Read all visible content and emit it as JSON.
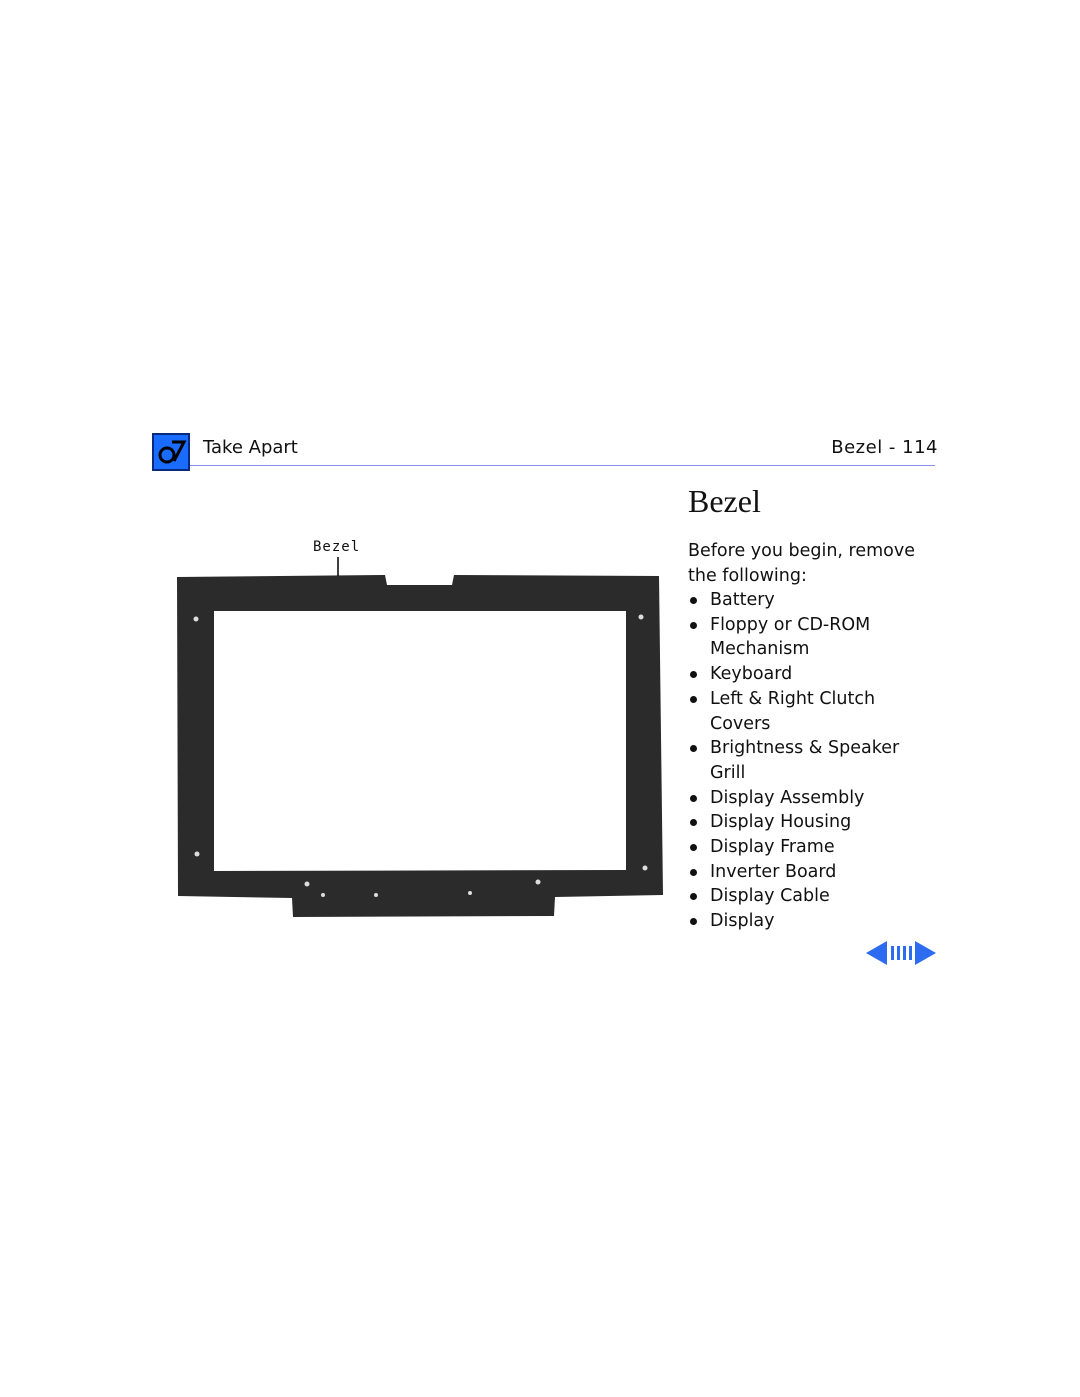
{
  "header": {
    "section": "Take Apart",
    "page_ref": "Bezel - 114",
    "logo_icon": "take-apart-wrench-icon",
    "accent_color": "#1a6cff"
  },
  "main": {
    "title": "Bezel",
    "intro": "Before you begin, remove the following:",
    "items": [
      {
        "label": "Battery"
      },
      {
        "label": "Floppy or CD-ROM Mechanism"
      },
      {
        "label": "Keyboard"
      },
      {
        "label": "Left & Right Clutch Covers"
      },
      {
        "label": "Brightness & Speaker Grill"
      },
      {
        "label": "Display Assembly"
      },
      {
        "label": "Display Housing"
      },
      {
        "label": "Display Frame"
      },
      {
        "label": "Inverter Board"
      },
      {
        "label": "Display Cable"
      },
      {
        "label": "Display"
      }
    ]
  },
  "figure": {
    "callout": "Bezel"
  },
  "nav": {
    "prev_icon": "left-arrow-icon",
    "browse_icon": "page-bars-icon",
    "next_icon": "right-arrow-icon",
    "color": "#2d6cf0"
  }
}
